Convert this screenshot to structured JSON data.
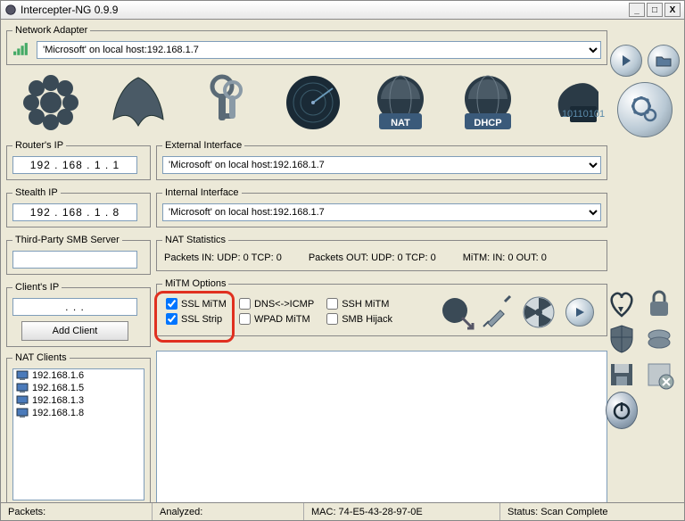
{
  "title": "Intercepter-NG 0.9.9",
  "network_adapter": {
    "legend": "Network Adapter",
    "value": "'Microsoft' on local host:192.168.1.7"
  },
  "router_ip": {
    "legend": "Router's IP",
    "value": "192 . 168 .   1  .   1"
  },
  "stealth_ip": {
    "legend": "Stealth IP",
    "value": "192 . 168 .   1  .   8"
  },
  "smb_server": {
    "legend": "Third-Party SMB Server",
    "value": ""
  },
  "client_ip": {
    "legend": "Client's IP",
    "value": " .        .        .  ",
    "button": "Add Client"
  },
  "ext_iface": {
    "legend": "External Interface",
    "value": "'Microsoft' on local host:192.168.1.7"
  },
  "int_iface": {
    "legend": "Internal Interface",
    "value": "'Microsoft' on local host:192.168.1.7"
  },
  "nat_stats": {
    "legend": "NAT Statistics",
    "in": "Packets IN: UDP: 0 TCP: 0",
    "out": "Packets OUT: UDP: 0 TCP: 0",
    "mitm": "MiTM: IN: 0 OUT: 0"
  },
  "mitm_options": {
    "legend": "MiTM Options",
    "ssl_mitm": "SSL MiTM",
    "ssl_strip": "SSL Strip",
    "dns_icmp": "DNS<->ICMP",
    "wpad": "WPAD MiTM",
    "ssh_mitm": "SSH MiTM",
    "smb_hijack": "SMB Hijack"
  },
  "nat_clients": {
    "legend": "NAT Clients",
    "items": [
      "192.168.1.6",
      "192.168.1.5",
      "192.168.1.3",
      "192.168.1.8"
    ]
  },
  "statusbar": {
    "packets": "Packets:",
    "analyzed": "Analyzed:",
    "mac": "MAC: 74-E5-43-28-97-0E",
    "status": "Status: Scan Complete"
  }
}
